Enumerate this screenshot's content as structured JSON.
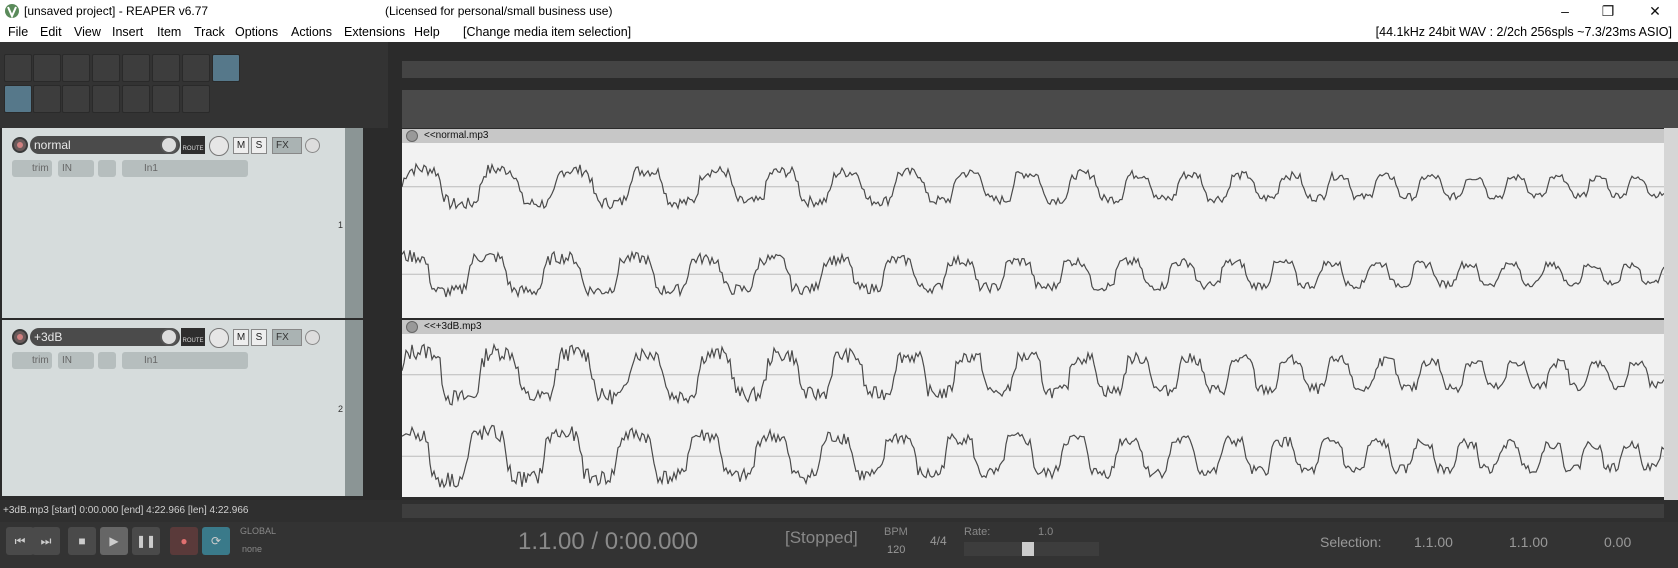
{
  "window": {
    "title": "[unsaved project] - REAPER v6.77",
    "license": "(Licensed for personal/small business use)"
  },
  "menu": {
    "items": [
      "File",
      "Edit",
      "View",
      "Insert",
      "Item",
      "Track",
      "Options",
      "Actions",
      "Extensions",
      "Help"
    ],
    "context": "[Change media item selection]",
    "audio_status": "[44.1kHz 24bit WAV : 2/2ch 256spls ~7.3/23ms ASIO]"
  },
  "tracks": [
    {
      "name": "normal",
      "number": "1",
      "route": "ROUTE",
      "mute": "M",
      "solo": "S",
      "fx": "FX",
      "trim": "trim",
      "in": "IN",
      "input": "In1"
    },
    {
      "name": "+3dB",
      "number": "2",
      "route": "ROUTE",
      "mute": "M",
      "solo": "S",
      "fx": "FX",
      "trim": "trim",
      "in": "IN",
      "input": "In1"
    }
  ],
  "items": [
    {
      "name": "<<normal.mp3"
    },
    {
      "name": "<<+3dB.mp3"
    }
  ],
  "status": {
    "item_info": "+3dB.mp3 [start] 0:00.000 [end] 4:22.966 [len] 4:22.966"
  },
  "transport": {
    "position": "1.1.00 / 0:00.000",
    "state": "[Stopped]",
    "bpm_label": "BPM",
    "bpm": "120",
    "time_sig": "4/4",
    "rate_label": "Rate:",
    "rate": "1.0",
    "global_label": "GLOBAL",
    "global_value": "none",
    "selection_label": "Selection:",
    "sel_start": "1.1.00",
    "sel_end": "1.1.00",
    "sel_len": "0.00"
  },
  "colors": {
    "track_panel": "#d6dcdc",
    "item_bg": "#f2f2f2",
    "waveform": "#4a4a4a",
    "accent": "#56788a"
  }
}
